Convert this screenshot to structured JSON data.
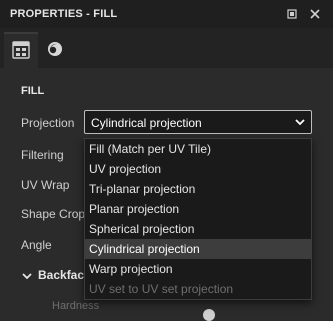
{
  "window": {
    "title": "PROPERTIES - FILL"
  },
  "tabs": [
    {
      "name": "fill-properties-tab",
      "icon": "grid-icon"
    },
    {
      "name": "material-tab",
      "icon": "sphere-icon"
    }
  ],
  "section": {
    "title": "FILL"
  },
  "fields": {
    "projection_label": "Projection",
    "filtering_label": "Filtering",
    "uvwrap_label": "UV Wrap",
    "shapecrop_label": "Shape Crop",
    "angle_label": "Angle"
  },
  "projection": {
    "selected": "Cylindrical projection",
    "options": [
      {
        "label": "Fill (Match per UV Tile)",
        "state": "normal"
      },
      {
        "label": "UV projection",
        "state": "normal"
      },
      {
        "label": "Tri-planar projection",
        "state": "normal"
      },
      {
        "label": "Planar projection",
        "state": "normal"
      },
      {
        "label": "Spherical projection",
        "state": "normal"
      },
      {
        "label": "Cylindrical projection",
        "state": "selected"
      },
      {
        "label": "Warp projection",
        "state": "normal"
      },
      {
        "label": "UV set to UV set projection",
        "state": "disabled"
      }
    ]
  },
  "backface": {
    "label": "Backface"
  },
  "hardness": {
    "label": "Hardness"
  },
  "colors": {
    "background": "#2b2b2b",
    "titlebar": "#1f1f1f",
    "dropdown": "#1a1a1a",
    "selected": "#3d3d3d"
  }
}
